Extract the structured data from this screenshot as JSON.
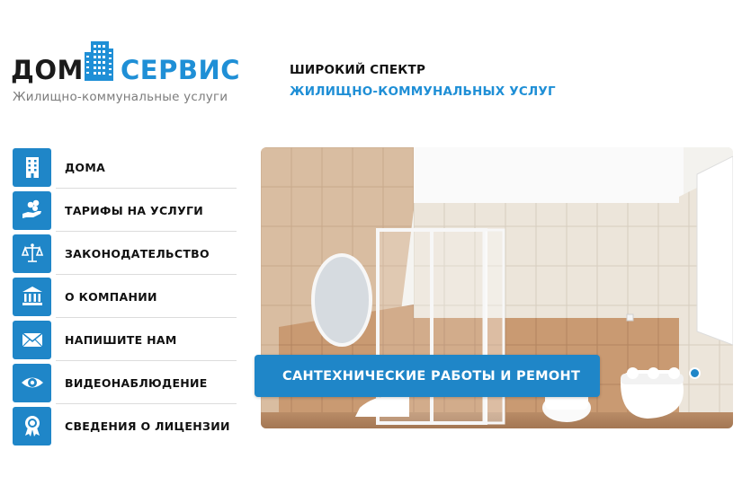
{
  "logo": {
    "word1": "ДОМ",
    "word2": "СЕРВИС",
    "subtitle": "Жилищно-коммунальные услуги",
    "icon": "building-icon"
  },
  "tagline": {
    "line1": "ШИРОКИЙ СПЕКТР",
    "line2": "ЖИЛИЩНО-КОММУНАЛЬНЫХ УСЛУГ"
  },
  "menu": {
    "items": [
      {
        "label": "ДОМА",
        "icon": "building-icon"
      },
      {
        "label": "ТАРИФЫ НА УСЛУГИ",
        "icon": "coins-hand-icon"
      },
      {
        "label": "ЗАКОНОДАТЕЛЬСТВО",
        "icon": "scales-icon"
      },
      {
        "label": "О КОМПАНИИ",
        "icon": "bank-icon"
      },
      {
        "label": "НАПИШИТЕ НАМ",
        "icon": "envelope-icon"
      },
      {
        "label": "ВИДЕОНАБЛЮДЕНИЕ",
        "icon": "eye-icon"
      },
      {
        "label": "СВЕДЕНИЯ О ЛИЦЕНЗИИ",
        "icon": "award-badge-icon"
      }
    ]
  },
  "slider": {
    "caption": "САНТЕХНИЧЕСКИЕ РАБОТЫ И РЕМОНТ",
    "slide_count": 4,
    "active_slide": 4
  },
  "colors": {
    "accent": "#1f86c8",
    "brand_blue": "#1f8fd6",
    "text_dark": "#111111",
    "subtitle_gray": "#7c7c7c"
  }
}
